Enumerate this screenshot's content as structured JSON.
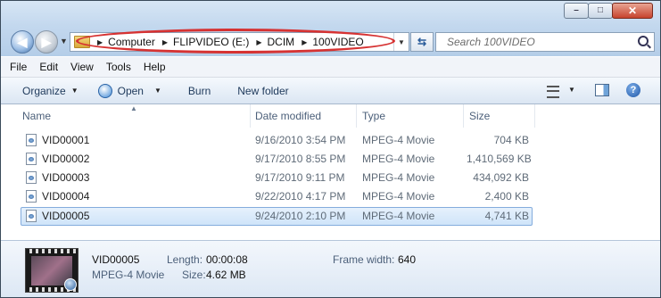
{
  "window": {
    "controls": {
      "minimize": "minimize-icon",
      "maximize": "maximize-icon",
      "close": "close-icon"
    }
  },
  "address": {
    "crumbs": [
      "Computer",
      "FLIPVIDEO (E:)",
      "DCIM",
      "100VIDEO"
    ],
    "highlight_color": "#d63232"
  },
  "search": {
    "placeholder": "Search 100VIDEO"
  },
  "menu": [
    "File",
    "Edit",
    "View",
    "Tools",
    "Help"
  ],
  "toolbar": {
    "organize": "Organize",
    "open": "Open",
    "burn": "Burn",
    "new_folder": "New folder"
  },
  "columns": {
    "name": "Name",
    "date": "Date modified",
    "type": "Type",
    "size": "Size"
  },
  "files": [
    {
      "name": "VID00001",
      "date": "9/16/2010 3:54 PM",
      "type": "MPEG-4 Movie",
      "size": "704 KB"
    },
    {
      "name": "VID00002",
      "date": "9/17/2010 8:55 PM",
      "type": "MPEG-4 Movie",
      "size": "1,410,569 KB"
    },
    {
      "name": "VID00003",
      "date": "9/17/2010 9:11 PM",
      "type": "MPEG-4 Movie",
      "size": "434,092 KB"
    },
    {
      "name": "VID00004",
      "date": "9/22/2010 4:17 PM",
      "type": "MPEG-4 Movie",
      "size": "2,400 KB"
    },
    {
      "name": "VID00005",
      "date": "9/24/2010 2:10 PM",
      "type": "MPEG-4 Movie",
      "size": "4,741 KB"
    }
  ],
  "selected_index": 4,
  "details": {
    "name": "VID00005",
    "type": "MPEG-4 Movie",
    "length_label": "Length:",
    "length": "00:00:08",
    "size_label": "Size:",
    "size": "4.62 MB",
    "frame_width_label": "Frame width:",
    "frame_width": "640"
  }
}
